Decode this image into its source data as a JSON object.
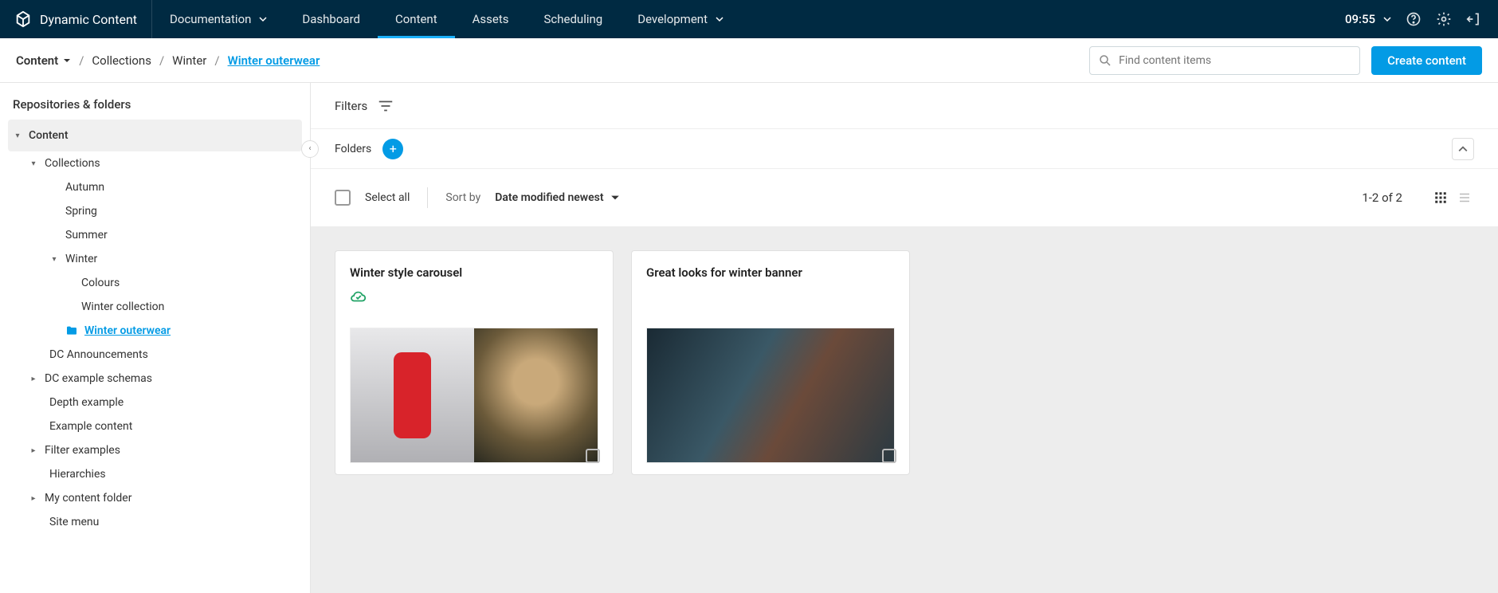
{
  "brand": "Dynamic Content",
  "nav": {
    "documentation": "Documentation",
    "dashboard": "Dashboard",
    "content": "Content",
    "assets": "Assets",
    "scheduling": "Scheduling",
    "development": "Development"
  },
  "time": "09:55",
  "breadcrumb": {
    "root": "Content",
    "collections": "Collections",
    "winter": "Winter",
    "current": "Winter outerwear"
  },
  "search_placeholder": "Find content items",
  "create_button": "Create content",
  "sidebar_title": "Repositories & folders",
  "tree": {
    "content": "Content",
    "collections": "Collections",
    "autumn": "Autumn",
    "spring": "Spring",
    "summer": "Summer",
    "winter": "Winter",
    "colours": "Colours",
    "winter_collection": "Winter collection",
    "winter_outerwear": "Winter outerwear",
    "dc_announcements": "DC Announcements",
    "dc_example_schemas": "DC example schemas",
    "depth_example": "Depth example",
    "example_content": "Example content",
    "filter_examples": "Filter examples",
    "hierarchies": "Hierarchies",
    "my_content_folder": "My content folder",
    "site_menu": "Site menu"
  },
  "filters_label": "Filters",
  "folders_label": "Folders",
  "select_all": "Select all",
  "sort_by_label": "Sort by",
  "sort_value": "Date modified newest",
  "result_count": "1-2 of 2",
  "cards": [
    {
      "title": "Winter style carousel",
      "has_cloud_icon": true
    },
    {
      "title": "Great looks for winter banner",
      "has_cloud_icon": false
    }
  ]
}
